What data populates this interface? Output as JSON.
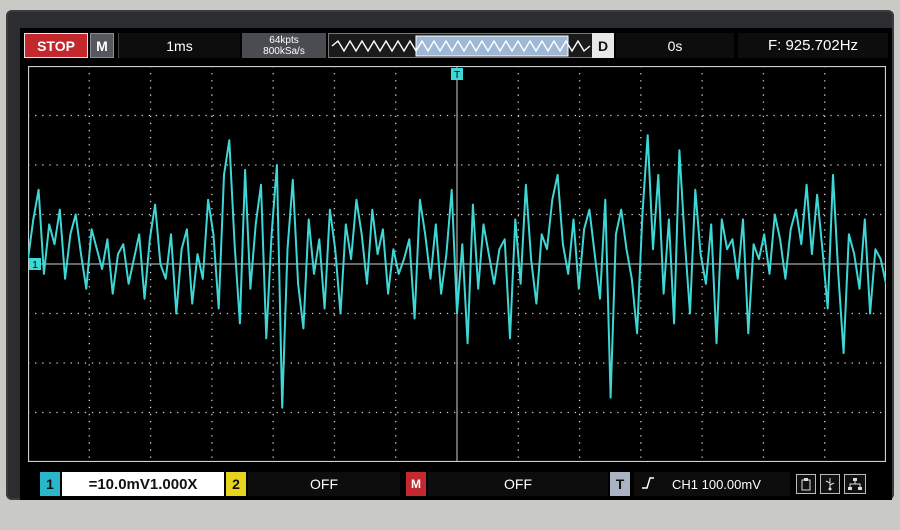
{
  "top_bar": {
    "run_state": "STOP",
    "menu_label": "M",
    "timebase": "1ms",
    "memory_depth": "64kpts",
    "sample_rate": "800kSa/s",
    "delay_label": "D",
    "delay_value": "0s",
    "frequency": "F: 925.702Hz"
  },
  "bottom_bar": {
    "ch1_index": "1",
    "ch1_setting": "=10.0mV1.000X",
    "ch2_index": "2",
    "ch2_setting": "OFF",
    "math_index": "M",
    "math_setting": "OFF",
    "trigger_index": "T",
    "trigger_edge_icon": "rising-edge-icon",
    "trigger_setting": "CH1 100.00mV",
    "status_icons": [
      "usb-storage-icon",
      "usb-icon",
      "network-icon"
    ]
  },
  "display": {
    "trace_color": "#3fd6d6",
    "grid_color": "#cfcfcf",
    "ch1_marker": "1",
    "trigger_marker": "T",
    "divisions_x": 14,
    "divisions_y": 8
  },
  "chart_data": {
    "type": "line",
    "x_divisions": 14,
    "y_divisions": 8,
    "ylim_div": [
      -4,
      4
    ],
    "series": [
      {
        "name": "CH1",
        "color": "#3fd6d6",
        "values_div": [
          0.1,
          0.9,
          1.5,
          -0.2,
          0.8,
          0.4,
          1.1,
          -0.3,
          0.6,
          1.0,
          0.2,
          -0.5,
          0.7,
          0.3,
          -0.1,
          0.5,
          -0.6,
          0.2,
          0.4,
          -0.4,
          0.1,
          0.6,
          -0.7,
          0.5,
          1.2,
          0.0,
          -0.3,
          0.6,
          -1.0,
          0.3,
          0.7,
          -0.8,
          0.2,
          -0.3,
          1.3,
          0.6,
          -0.9,
          1.8,
          2.5,
          0.4,
          -1.2,
          1.9,
          -0.5,
          0.8,
          1.6,
          -1.5,
          0.6,
          2.0,
          -2.9,
          0.3,
          1.7,
          -0.4,
          -1.3,
          0.9,
          -0.2,
          0.5,
          -0.9,
          1.1,
          0.3,
          -1.0,
          0.8,
          0.1,
          1.3,
          0.6,
          -0.4,
          1.1,
          0.2,
          0.7,
          -0.6,
          0.3,
          -0.2,
          0.1,
          0.5,
          -1.1,
          1.3,
          0.6,
          -0.3,
          0.8,
          -0.6,
          0.2,
          1.5,
          -1.0,
          0.4,
          -1.6,
          1.2,
          -0.5,
          0.8,
          0.2,
          -0.4,
          0.3,
          0.5,
          -1.5,
          0.9,
          -0.4,
          1.6,
          0.1,
          -0.8,
          0.6,
          0.3,
          1.3,
          1.8,
          0.4,
          -0.2,
          0.9,
          -0.5,
          0.7,
          1.1,
          0.2,
          -0.7,
          1.3,
          -2.7,
          0.6,
          1.1,
          0.3,
          -0.3,
          -1.4,
          1.0,
          2.6,
          0.3,
          1.8,
          -0.6,
          0.9,
          -1.2,
          2.3,
          0.5,
          -1.0,
          1.5,
          0.2,
          -0.4,
          0.8,
          -1.6,
          0.9,
          0.3,
          0.5,
          -0.3,
          0.9,
          -1.4,
          0.4,
          0.1,
          0.6,
          -0.2,
          1.0,
          0.5,
          -0.3,
          0.7,
          1.1,
          0.4,
          1.6,
          0.2,
          1.4,
          0.3,
          -0.9,
          1.8,
          -0.2,
          -1.8,
          0.6,
          0.2,
          -0.5,
          0.9,
          -1.0,
          0.3,
          0.1,
          -0.4
        ]
      }
    ]
  }
}
